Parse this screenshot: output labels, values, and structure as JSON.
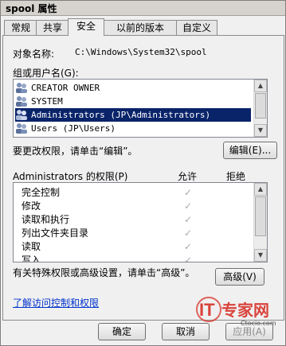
{
  "window": {
    "title": "spool 属性"
  },
  "tabs": [
    "常规",
    "共享",
    "安全",
    "以前的版本",
    "自定义"
  ],
  "object": {
    "label": "对象名称:",
    "path": "C:\\Windows\\System32\\spool"
  },
  "groups": {
    "label": "组或用户名(G):",
    "items": [
      {
        "name": "CREATOR OWNER",
        "selected": false
      },
      {
        "name": "SYSTEM",
        "selected": false
      },
      {
        "name": "Administrators (JP\\Administrators)",
        "selected": true
      },
      {
        "name": "Users (JP\\Users)",
        "selected": false
      }
    ]
  },
  "change": {
    "text": "要更改权限，请单击“编辑”。",
    "edit_button": "编辑(E)..."
  },
  "permissions": {
    "title": "Administrators 的权限(P)",
    "allow_header": "允许",
    "deny_header": "拒绝",
    "items": [
      "完全控制",
      "修改",
      "读取和执行",
      "列出文件夹目录",
      "读取",
      "写入"
    ]
  },
  "advanced": {
    "text": "有关特殊权限或高级设置，请单击“高级”。",
    "button": "高级(V)"
  },
  "learn_link": "了解访问控制和权限",
  "buttons": {
    "ok": "确定",
    "cancel": "取消",
    "apply": "应用(A)"
  },
  "watermark": {
    "brand": "IT专家网",
    "url": "Ctocio.com"
  },
  "colors": {
    "selection": "#0a246a",
    "link": "#0033cc",
    "brand_red": "#d6261d"
  }
}
